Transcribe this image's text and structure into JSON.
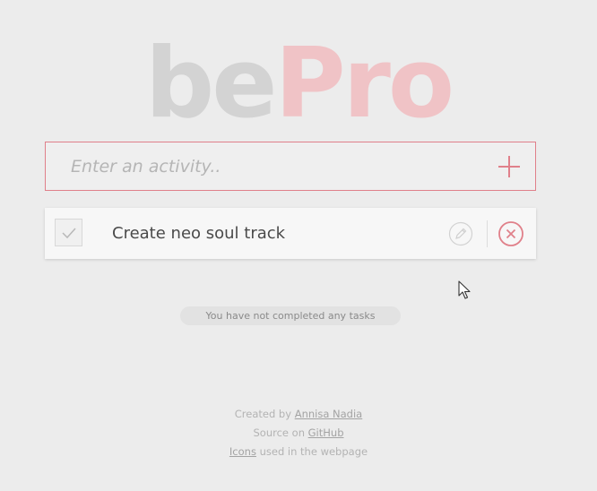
{
  "logo": {
    "part1": "be",
    "part2": "Pro"
  },
  "entry": {
    "placeholder": "Enter an activity..",
    "value": "",
    "add_icon": "plus-icon"
  },
  "tasks": [
    {
      "label": "Create neo soul track",
      "completed": false,
      "icons": [
        "check-icon",
        "pencil-icon",
        "close-circle-icon"
      ]
    }
  ],
  "status": {
    "text": "You have not completed any tasks"
  },
  "footer": {
    "created_prefix": "Created by ",
    "author": "Annisa Nadia",
    "source_prefix": "Source on ",
    "source_link": "GitHub",
    "icons_link": "Icons",
    "icons_suffix": " used in the webpage"
  },
  "colors": {
    "accent": "#e0808a",
    "logo_light": "#d3d3d3",
    "logo_pink": "#f0c3c6",
    "background": "#ececec"
  }
}
